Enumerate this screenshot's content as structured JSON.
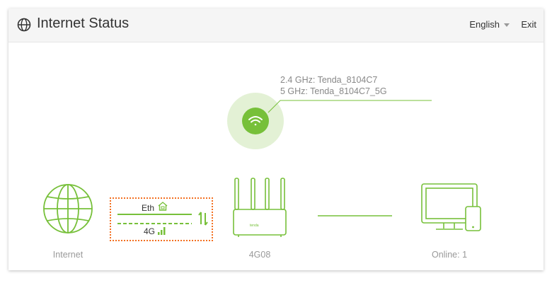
{
  "header": {
    "title": "Internet Status",
    "language": "English",
    "exit_label": "Exit"
  },
  "wifi": {
    "band_24": "2.4 GHz: Tenda_8104C7",
    "band_5": "5 GHz: Tenda_8104C7_5G"
  },
  "topology": {
    "internet_label": "Internet",
    "eth_label": "Eth",
    "lte_label": "4G",
    "router_label": "4G08",
    "router_brand": "tenda",
    "online_label": "Online: 1"
  },
  "colors": {
    "accent": "#77c03a",
    "wan_border": "#f37021"
  }
}
